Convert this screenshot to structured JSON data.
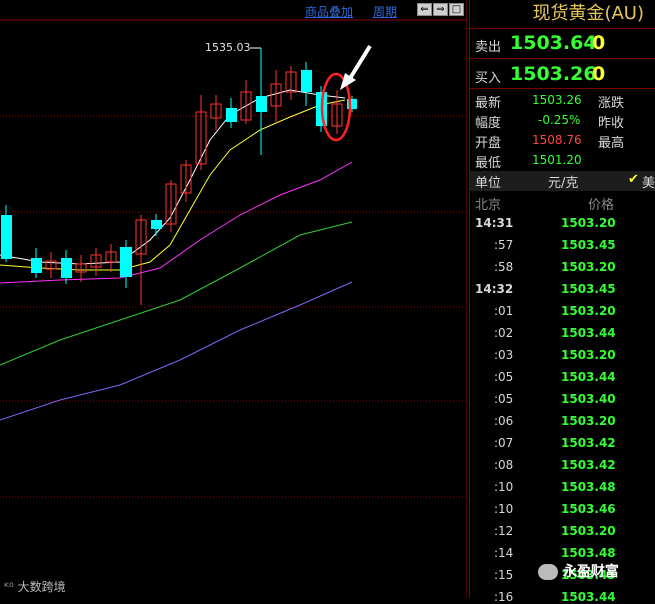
{
  "chart": {
    "menu_overlay": "商品叠加",
    "menu_period": "周期",
    "btn_left": "⇐",
    "btn_right": "⇒",
    "btn_box": "□",
    "high_label": "1535.03",
    "colors": {
      "up": "#ff3333",
      "down": "#00ffff",
      "ma5": "#ffffff",
      "ma10": "#ffff33",
      "ma20": "#ff33ff",
      "ma40": "#33cc33",
      "ma60": "#7b68ee",
      "annotation": "#ff2020"
    }
  },
  "panel": {
    "title": "现货黄金(AU)",
    "sell_label": "卖出",
    "sell_value": "1503.64",
    "sell_size": "0",
    "buy_label": "买入",
    "buy_value": "1503.26",
    "buy_size": "0",
    "stats": [
      {
        "label": "最新",
        "value": "1503.26",
        "color": "g",
        "label2": "涨跌"
      },
      {
        "label": "幅度",
        "value": "-0.25%",
        "color": "g",
        "label2": "昨收"
      },
      {
        "label": "开盘",
        "value": "1508.76",
        "color": "r",
        "label2": "最高"
      },
      {
        "label": "最低",
        "value": "1501.20",
        "color": "g",
        "label2": ""
      }
    ],
    "unit_label": "单位",
    "unit_value": "元/克",
    "unit_check": "✔",
    "unit_extra": "美",
    "col_left": "北京",
    "col_right": "价格",
    "ticks": [
      {
        "time": "14:31",
        "price": "1503.20"
      },
      {
        "time": ":57",
        "price": "1503.45"
      },
      {
        "time": ":58",
        "price": "1503.20"
      },
      {
        "time": "14:32",
        "price": "1503.45"
      },
      {
        "time": ":01",
        "price": "1503.20"
      },
      {
        "time": ":02",
        "price": "1503.44"
      },
      {
        "time": ":03",
        "price": "1503.20"
      },
      {
        "time": ":05",
        "price": "1503.44"
      },
      {
        "time": ":05",
        "price": "1503.40"
      },
      {
        "time": ":06",
        "price": "1503.20"
      },
      {
        "time": ":07",
        "price": "1503.42"
      },
      {
        "time": ":08",
        "price": "1503.42"
      },
      {
        "time": ":10",
        "price": "1503.48"
      },
      {
        "time": ":10",
        "price": "1503.46"
      },
      {
        "time": ":12",
        "price": "1503.20"
      },
      {
        "time": ":14",
        "price": "1503.48"
      },
      {
        "time": ":15",
        "price": "1503.45"
      },
      {
        "time": ":16",
        "price": "1503.44"
      }
    ]
  },
  "watermark_left": "大数跨境",
  "watermark_right": "永盈财富"
}
